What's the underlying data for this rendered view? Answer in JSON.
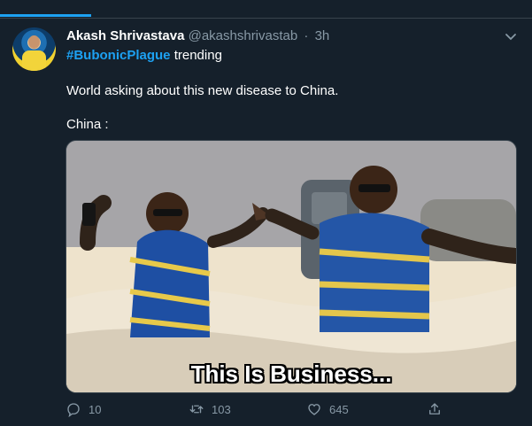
{
  "tweet": {
    "display_name": "Akash Shrivastava",
    "handle": "@akashshrivastab",
    "separator": "·",
    "time": "3h",
    "hashtag": "#BubonicPlague",
    "trend_word": "trending",
    "line1": "World asking about this new disease to China.",
    "line2": "China :",
    "media_caption": "This Is Business...",
    "actions": {
      "reply_count": "10",
      "retweet_count": "103",
      "like_count": "645"
    },
    "icons": {
      "avatar": "avatar-image",
      "menu": "chevron-down-icon",
      "reply": "reply-icon",
      "retweet": "retweet-icon",
      "like": "heart-icon",
      "share": "share-icon"
    }
  },
  "colors": {
    "background": "#15202b",
    "accent": "#1da1f2",
    "muted": "#8899a6",
    "border": "#38444d"
  }
}
